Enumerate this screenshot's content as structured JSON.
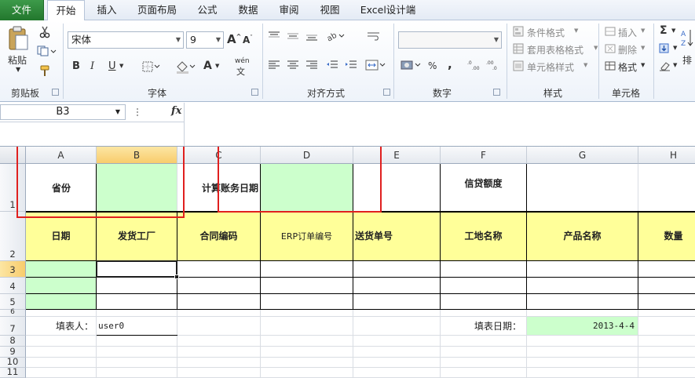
{
  "tabs": [
    {
      "label": "文件"
    },
    {
      "label": "开始"
    },
    {
      "label": "插入"
    },
    {
      "label": "页面布局"
    },
    {
      "label": "公式"
    },
    {
      "label": "数据"
    },
    {
      "label": "审阅"
    },
    {
      "label": "视图"
    },
    {
      "label": "Excel设计端"
    }
  ],
  "ribbon": {
    "clipboard": {
      "paste_label": "粘贴",
      "group_label": "剪贴板"
    },
    "font": {
      "font_name": "宋体",
      "font_size": "9",
      "group_label": "字体",
      "bold_glyph": "B",
      "italic_glyph": "I",
      "underline_glyph": "U",
      "font_color_glyph": "A",
      "wen_glyph": "wén"
    },
    "alignment": {
      "group_label": "对齐方式"
    },
    "number": {
      "format_value": "",
      "percent_glyph": "%",
      "comma_glyph": ",",
      "group_label": "数字"
    },
    "styles": {
      "conditional": "条件格式",
      "table_format": "套用表格格式",
      "cell_styles": "单元格样式",
      "group_label": "样式"
    },
    "cells": {
      "insert": "插入",
      "delete": "删除",
      "format": "格式",
      "group_label": "单元格"
    },
    "editing": {
      "sigma_glyph": "Σ",
      "sort_label": "排"
    }
  },
  "formula_bar": {
    "name_box": "B3",
    "fx_label": "fx",
    "formula": ""
  },
  "columns": [
    "A",
    "B",
    "C",
    "D",
    "E",
    "F",
    "G",
    "H"
  ],
  "rows": [
    "1",
    "2",
    "3",
    "4",
    "5",
    "6",
    "7",
    "8",
    "9",
    "10",
    "11"
  ],
  "sheet": {
    "row1": {
      "province_label": "省份",
      "account_date_label": "计算账务日期",
      "credit_label": "信贷额度"
    },
    "row2": {
      "headers": [
        "日期",
        "发货工厂",
        "合同编码",
        "ERP订单编号",
        "送货单号",
        "工地名称",
        "产品名称",
        "数量"
      ]
    },
    "row7": {
      "filler_label": "填表人：",
      "filler_value": "user0",
      "fill_date_label": "填表日期：",
      "fill_date_value": "2013-4-4"
    }
  },
  "colors": {
    "green_fill": "#ccffcc",
    "yellow_fill": "#ffff99",
    "highlight_red": "#e0201f",
    "file_tab_green": "#2a8236"
  }
}
